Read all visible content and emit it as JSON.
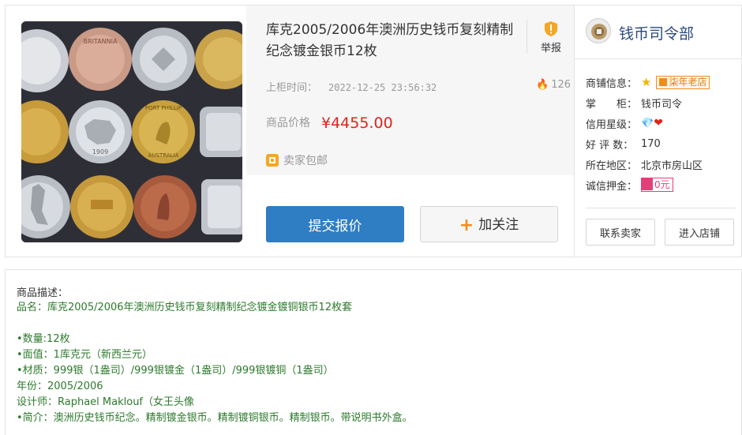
{
  "product": {
    "title": "库克2005/2006年澳洲历史钱币复刻精制纪念镀金银币12枚",
    "report_label": "举报",
    "listed_label": "上柜时间：",
    "listed_time": "2022-12-25  23:56:32",
    "views": "126",
    "price_label": "商品价格",
    "price": "¥4455.00",
    "shipping": "卖家包邮",
    "offer_button": "提交报价",
    "follow_button": "加关注",
    "image_coin_texts": [
      "BRITANNIA",
      "PORT PHILLIP",
      "AUSTRALIA",
      "1909"
    ]
  },
  "shop": {
    "name": "钱币司令部",
    "rows": [
      {
        "label": "商铺信息：",
        "badge": "柒年老店"
      },
      {
        "label": "掌　　柜：",
        "value": "钱币司令"
      },
      {
        "label": "信用星级：",
        "value": ""
      },
      {
        "label": "好 评 数：",
        "value": "170"
      },
      {
        "label": "所在地区：",
        "value": "北京市房山区"
      },
      {
        "label": "诚信押金：",
        "badge": "0元"
      }
    ],
    "contact_button": "联系卖家",
    "enter_button": "进入店铺"
  },
  "description": {
    "header": "商品描述：",
    "lines": [
      "品名：库克2005/2006年澳洲历史钱币复刻精制纪念镀金镀铜银币12枚套",
      "",
      "•数量:12枚",
      "•面值：1库克元（新西兰元）",
      "•材质：999银（1盎司）/999银镀金（1盎司）/999银镀铜（1盎司）",
      "年份：2005/2006",
      "设计师：Raphael Maklouf（女王头像",
      "•简介：澳洲历史钱币纪念。精制镀金银币。精制镀铜银币。精制银币。带说明书外盒。"
    ]
  },
  "colors": {
    "accent_blue": "#2f7dc3",
    "price_red": "#e2231a",
    "desc_green": "#2d7a2d",
    "shop_name": "#2a4a7c"
  }
}
